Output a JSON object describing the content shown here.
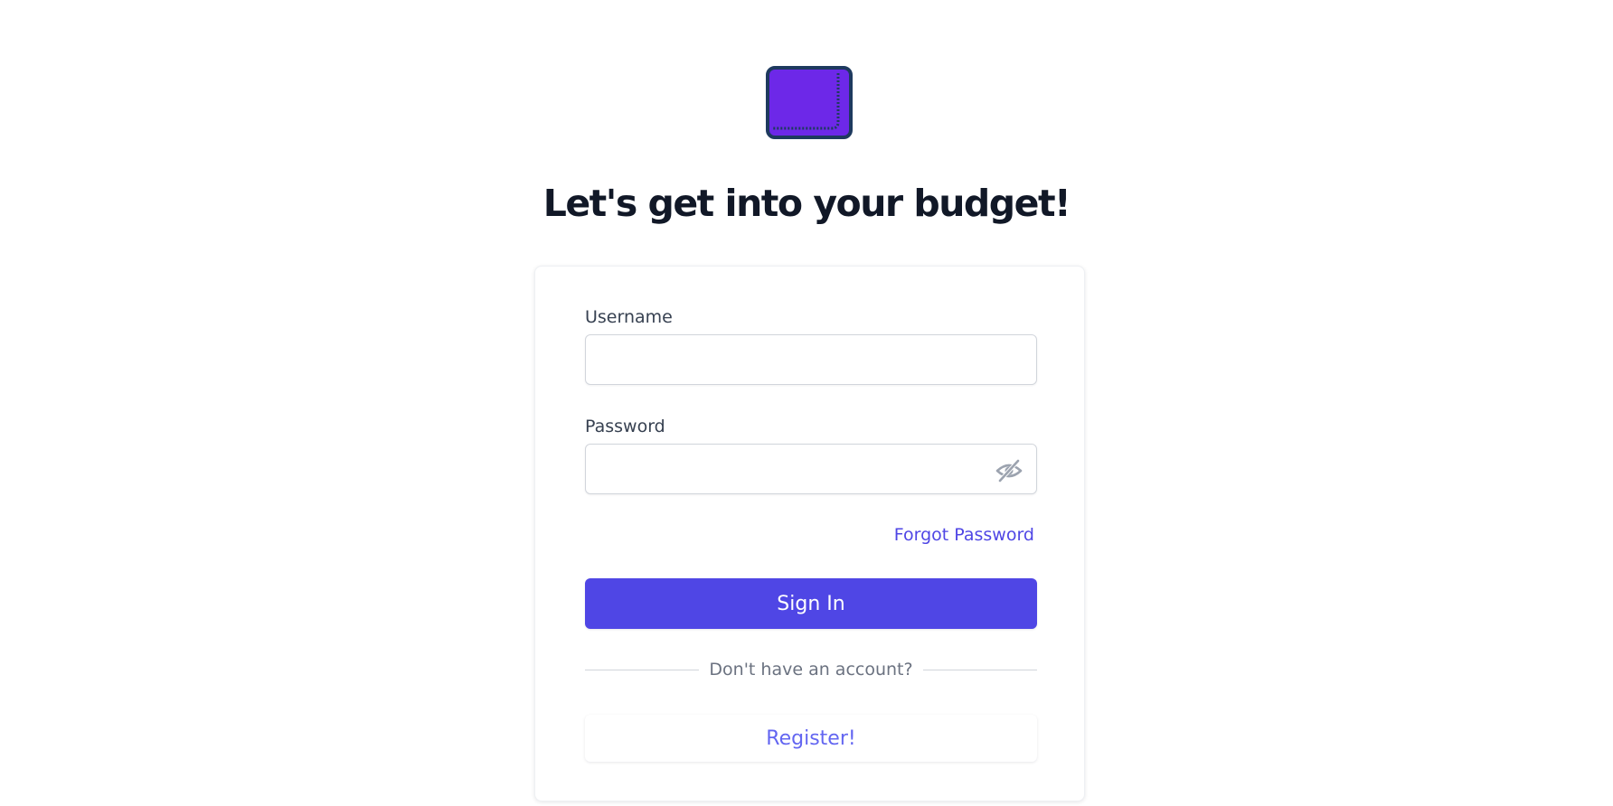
{
  "brand": {
    "logo_icon": "wallet-icon",
    "logo_color": "#6d28e8",
    "logo_border_color": "#1e3a5f"
  },
  "headline": "Let's get into your budget!",
  "form": {
    "username_label": "Username",
    "username_value": "",
    "password_label": "Password",
    "password_value": "",
    "toggle_visibility_icon": "eye-off-icon",
    "forgot_password": "Forgot Password",
    "sign_in": "Sign In",
    "divider_text": "Don't have an account?",
    "register": "Register!"
  },
  "colors": {
    "primary": "#4f46e5",
    "heading": "#111827",
    "muted": "#6b7280"
  }
}
